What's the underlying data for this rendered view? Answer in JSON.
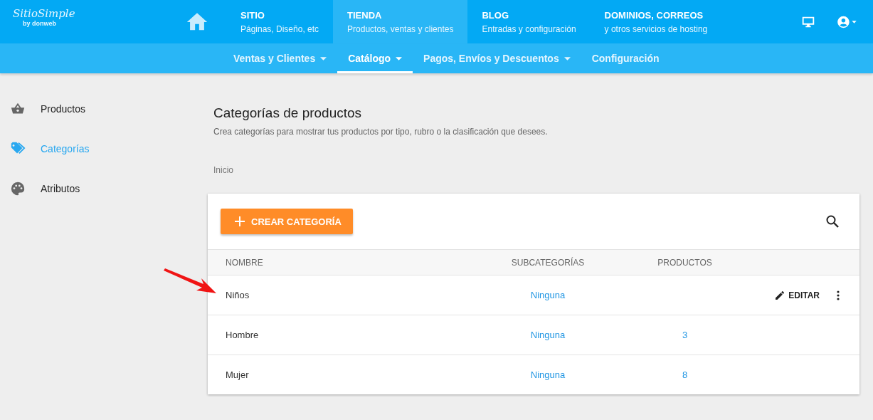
{
  "logo": {
    "name": "SitioSimple",
    "byline": "by donweb"
  },
  "main_tabs": [
    {
      "title": "SITIO",
      "subtitle": "Páginas, Diseño, etc",
      "selected": false
    },
    {
      "title": "TIENDA",
      "subtitle": "Productos, ventas y clientes",
      "selected": true
    },
    {
      "title": "BLOG",
      "subtitle": "Entradas y configuración",
      "selected": false
    },
    {
      "title": "DOMINIOS, CORREOS",
      "subtitle": "y otros servicios de hosting",
      "selected": false
    }
  ],
  "sub_tabs": [
    {
      "label": "Ventas y Clientes",
      "dropdown": true,
      "selected": false
    },
    {
      "label": "Catálogo",
      "dropdown": true,
      "selected": true
    },
    {
      "label": "Pagos, Envíos y Descuentos",
      "dropdown": true,
      "selected": false
    },
    {
      "label": "Configuración",
      "dropdown": false,
      "selected": false
    }
  ],
  "sidebar": {
    "items": [
      {
        "label": "Productos",
        "kind": "basket",
        "selected": false
      },
      {
        "label": "Categorías",
        "kind": "tag",
        "selected": true
      },
      {
        "label": "Atributos",
        "kind": "palette",
        "selected": false
      }
    ]
  },
  "page": {
    "title": "Categorías de productos",
    "description": "Crea categorías para mostrar tus productos por tipo, rubro o la clasificación que desees.",
    "breadcrumb": "Inicio"
  },
  "create_button": "CREAR CATEGORÍA",
  "table": {
    "columns": [
      "NOMBRE",
      "SUBCATEGORÍAS",
      "PRODUCTOS"
    ],
    "rows": [
      {
        "name": "Niños",
        "subcategories": "Ninguna",
        "actions": true,
        "edit_label": "EDITAR",
        "arrow": true
      },
      {
        "name": "Hombre",
        "subcategories": "Ninguna",
        "products": "3",
        "actions": false,
        "arrow": false
      },
      {
        "name": "Mujer",
        "subcategories": "Ninguna",
        "products": "8",
        "actions": false,
        "arrow": false
      }
    ]
  }
}
